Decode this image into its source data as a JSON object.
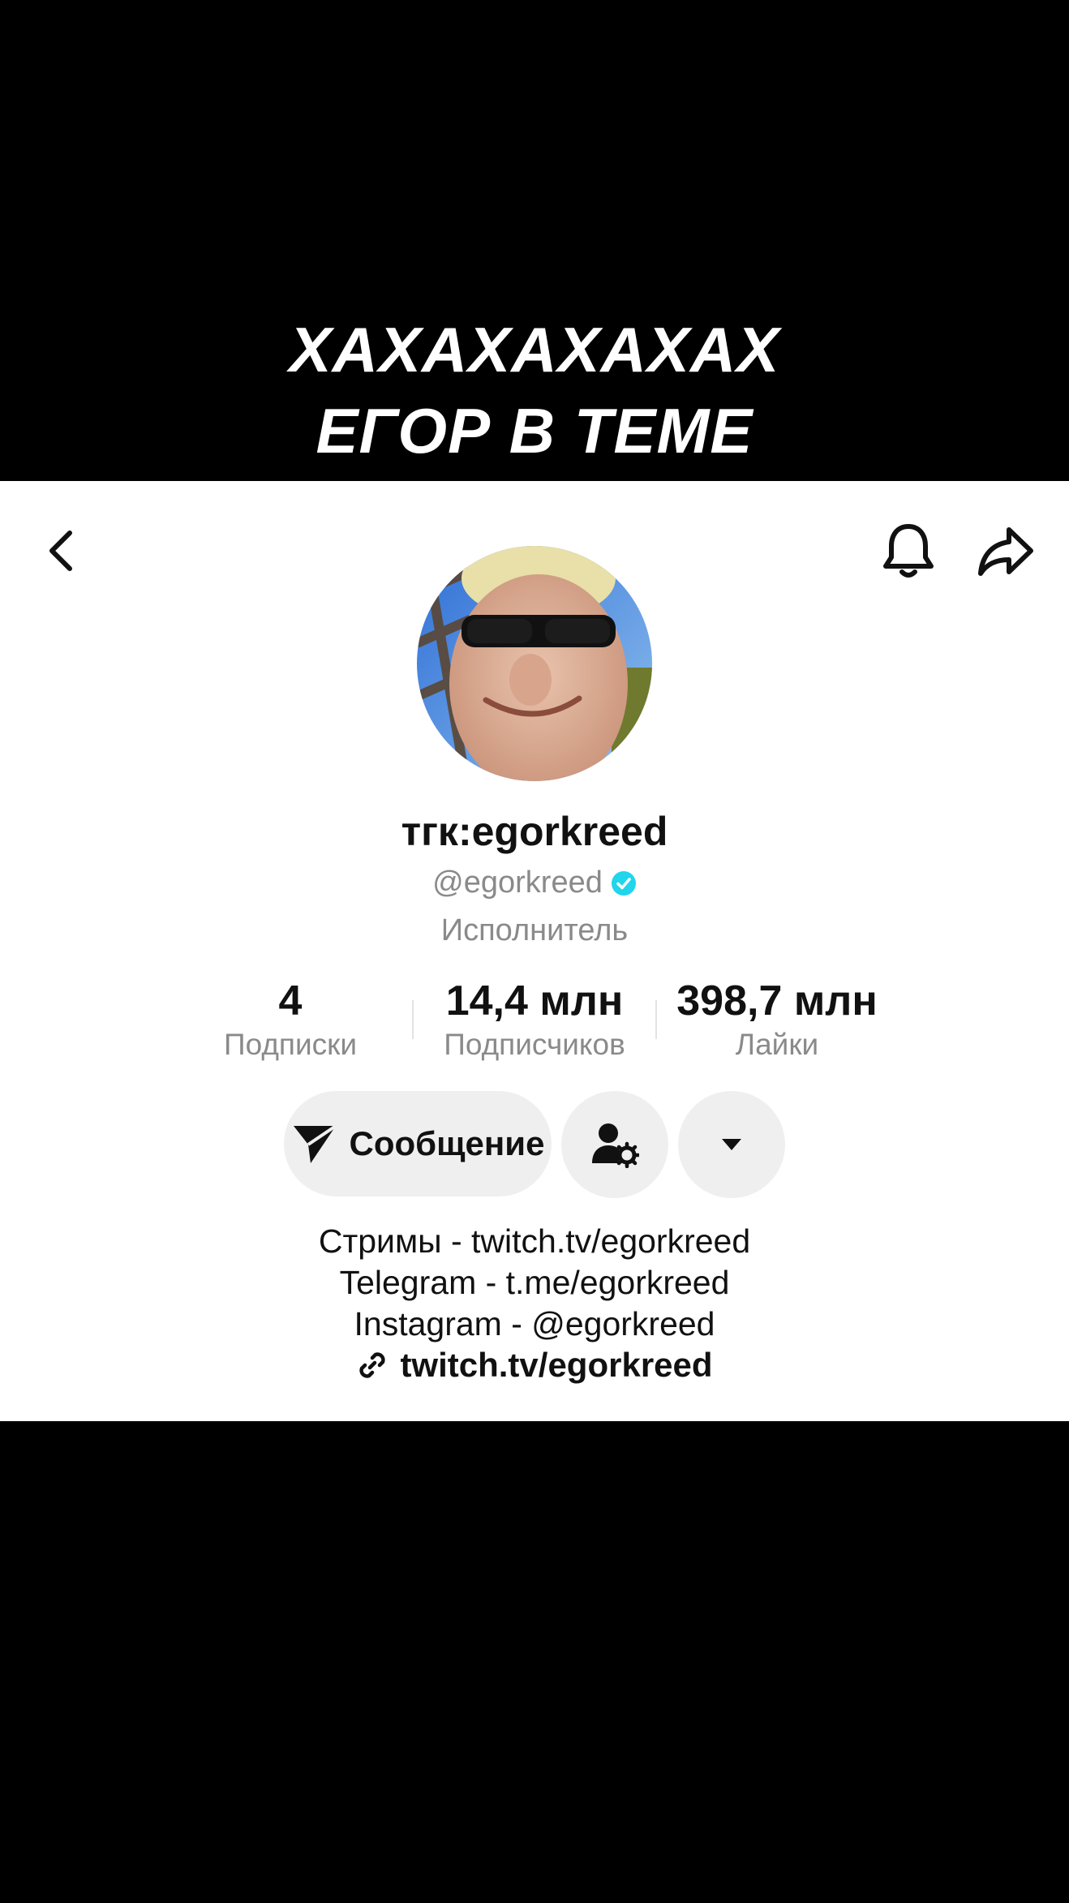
{
  "caption": {
    "line1": "ХАХАХАХАХАХ",
    "line2": "ЕГОР В ТЕМЕ"
  },
  "header": {
    "back_icon": "chevron-left-icon",
    "bell_icon": "bell-icon",
    "share_icon": "share-arrow-icon"
  },
  "profile": {
    "display_name": "тгк:egorkreed",
    "handle": "@egorkreed",
    "verified": true,
    "verified_color": "#20d5ec",
    "category": "Исполнитель"
  },
  "stats": {
    "following": {
      "value": "4",
      "label": "Подписки"
    },
    "followers": {
      "value": "14,4 млн",
      "label": "Подписчиков"
    },
    "likes": {
      "value": "398,7 млн",
      "label": "Лайки"
    }
  },
  "actions": {
    "message_label": "Сообщение",
    "message_icon": "send-icon",
    "friend_icon": "user-settings-icon",
    "more_icon": "caret-down-icon"
  },
  "bio": {
    "lines": [
      "Стримы - twitch.tv/egorkreed",
      "Telegram - t.me/egorkreed",
      "Instagram - @egorkreed"
    ],
    "link": "twitch.tv/egorkreed",
    "link_icon": "link-icon"
  },
  "colors": {
    "background": "#000000",
    "card": "#ffffff",
    "secondary_text": "#8a8a8a",
    "button_bg": "#efefef"
  }
}
